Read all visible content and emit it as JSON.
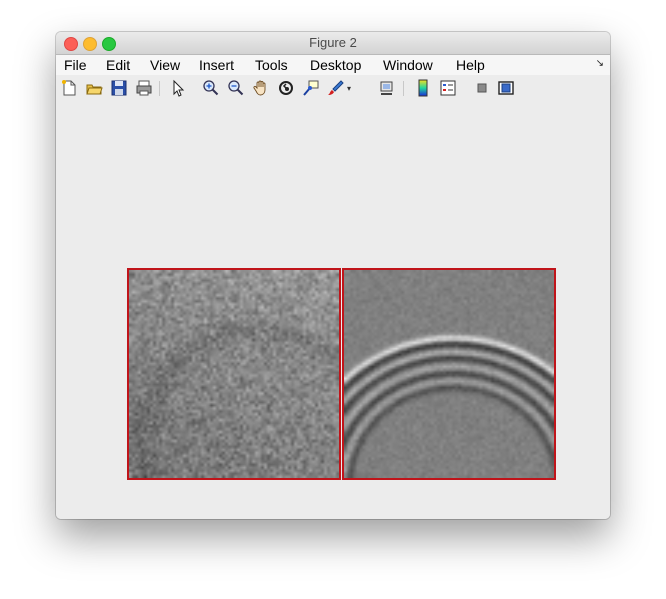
{
  "window": {
    "title": "Figure 2"
  },
  "menu": [
    "File",
    "Edit",
    "View",
    "Insert",
    "Tools",
    "Desktop",
    "Window",
    "Help"
  ],
  "toolbar": {
    "buttons": [
      "new-figure-icon",
      "open-file-icon",
      "save-icon",
      "print-icon",
      "edit-plot-arrow-icon",
      "zoom-in-icon",
      "zoom-out-icon",
      "pan-hand-icon",
      "rotate-3d-icon",
      "data-cursor-icon",
      "brush-icon",
      "link-plot-icon",
      "colorbar-icon",
      "legend-icon",
      "hide-plot-tools-icon",
      "show-plot-tools-icon"
    ]
  },
  "colors": {
    "panel_border": "#c0141a",
    "window_bg": "#ececec"
  },
  "images": [
    {
      "name": "noisy-grayscale-image"
    },
    {
      "name": "filtered-arc-image"
    }
  ]
}
